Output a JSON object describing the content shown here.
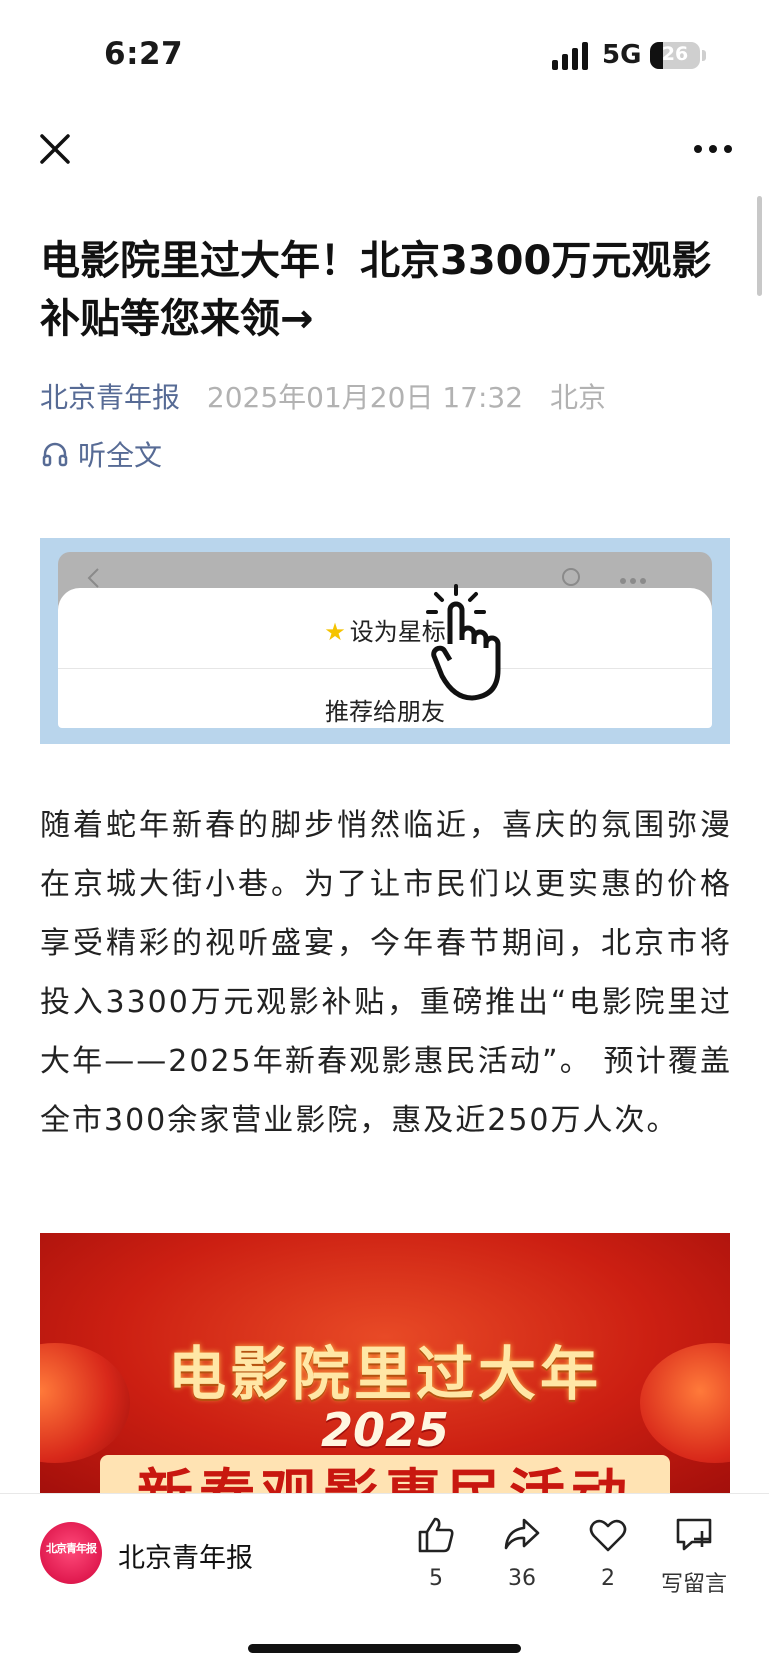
{
  "status_bar": {
    "time": "6:27",
    "network": "5G",
    "battery_level": "26",
    "battery_fraction": 0.26,
    "signal_bars": 4
  },
  "nav": {
    "close_icon": "close-icon",
    "more_icon": "more-dots-icon"
  },
  "article": {
    "title": "电影院里过大年！北京3300万元观影补贴等您来领→",
    "account": "北京青年报",
    "date": "2025年01月20日 17:32",
    "location": "北京",
    "listen_label": "听全文",
    "promo": {
      "star_label": "设为星标",
      "recommend_label": "推荐给朋友"
    },
    "paragraph": "随着蛇年新春的脚步悄然临近，喜庆的氛围弥漫在京城大街小巷。为了让市民们以更实惠的价格享受精彩的视听盛宴，今年春节期间，北京市将投入3300万元观影补贴，重磅推出“电影院里过大年——2025年新春观影惠民活动”。 预计覆盖全市300余家营业影院，惠及近250万人次。",
    "poster": {
      "title": "电影院里过大年",
      "year": "2025",
      "subtitle": "新春观影惠民活动"
    }
  },
  "bottom_bar": {
    "logo_text": "北京青年报",
    "account_name": "北京青年报",
    "like_count": "5",
    "share_count": "36",
    "favorite_count": "2",
    "comment_label": "写留言"
  }
}
